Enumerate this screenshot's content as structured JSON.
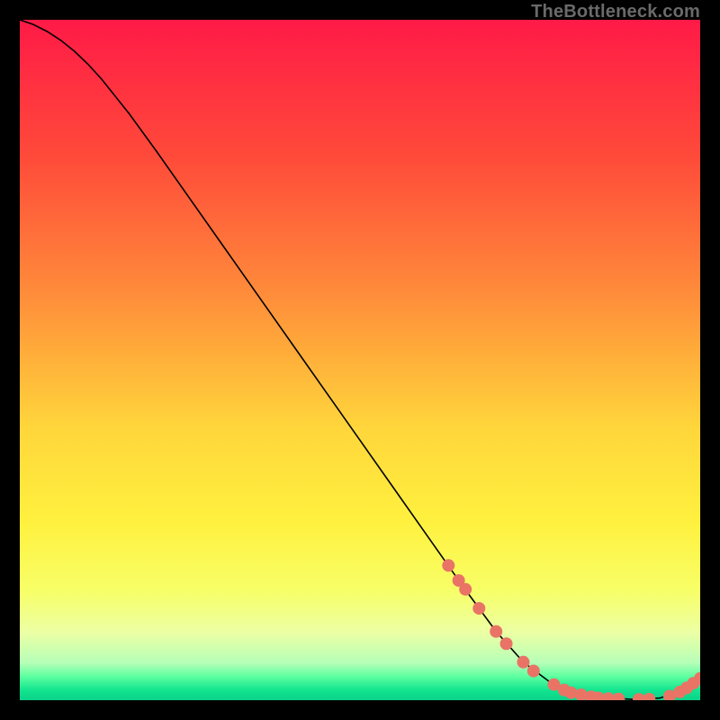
{
  "watermark": "TheBottleneck.com",
  "chart_data": {
    "type": "line",
    "title": "",
    "xlabel": "",
    "ylabel": "",
    "xlim": [
      0,
      100
    ],
    "ylim": [
      0,
      100
    ],
    "grid": false,
    "legend": false,
    "background": {
      "direction": "vertical",
      "stops": [
        {
          "pos": 0.0,
          "color": "#ff1a47"
        },
        {
          "pos": 0.2,
          "color": "#ff4a3a"
        },
        {
          "pos": 0.4,
          "color": "#ff8b3a"
        },
        {
          "pos": 0.6,
          "color": "#ffd63b"
        },
        {
          "pos": 0.74,
          "color": "#fff13f"
        },
        {
          "pos": 0.84,
          "color": "#f7ff68"
        },
        {
          "pos": 0.9,
          "color": "#ecffa4"
        },
        {
          "pos": 0.945,
          "color": "#b6ffb8"
        },
        {
          "pos": 0.965,
          "color": "#5effa0"
        },
        {
          "pos": 0.985,
          "color": "#12e58f"
        },
        {
          "pos": 1.0,
          "color": "#0bd188"
        }
      ]
    },
    "series": [
      {
        "name": "bottleneck-curve",
        "color": "#000000",
        "width": 1.6,
        "x": [
          0,
          2,
          4,
          6,
          8,
          10,
          12,
          16,
          20,
          25,
          30,
          35,
          40,
          45,
          50,
          55,
          60,
          65,
          70,
          74,
          78,
          82,
          86,
          90,
          94,
          97,
          100
        ],
        "y": [
          100,
          99.3,
          98.3,
          97.0,
          95.4,
          93.5,
          91.3,
          86.3,
          80.8,
          73.7,
          66.6,
          59.5,
          52.4,
          45.3,
          38.2,
          31.1,
          24.0,
          16.9,
          10.1,
          5.6,
          2.6,
          1.0,
          0.35,
          0.12,
          0.3,
          1.2,
          3.2
        ]
      }
    ],
    "markers": {
      "name": "highlighted-points",
      "color": "#e97466",
      "radius": 7,
      "points": [
        {
          "x": 63.0,
          "y": 19.8
        },
        {
          "x": 64.5,
          "y": 17.6
        },
        {
          "x": 65.5,
          "y": 16.3
        },
        {
          "x": 67.5,
          "y": 13.5
        },
        {
          "x": 70.0,
          "y": 10.1
        },
        {
          "x": 71.5,
          "y": 8.3
        },
        {
          "x": 74.0,
          "y": 5.6
        },
        {
          "x": 75.5,
          "y": 4.3
        },
        {
          "x": 78.5,
          "y": 2.3
        },
        {
          "x": 80.0,
          "y": 1.5
        },
        {
          "x": 81.0,
          "y": 1.1
        },
        {
          "x": 82.5,
          "y": 0.8
        },
        {
          "x": 84.0,
          "y": 0.5
        },
        {
          "x": 85.0,
          "y": 0.35
        },
        {
          "x": 86.5,
          "y": 0.25
        },
        {
          "x": 88.0,
          "y": 0.18
        },
        {
          "x": 91.0,
          "y": 0.12
        },
        {
          "x": 92.5,
          "y": 0.15
        },
        {
          "x": 95.5,
          "y": 0.6
        },
        {
          "x": 97.0,
          "y": 1.2
        },
        {
          "x": 98.0,
          "y": 1.8
        },
        {
          "x": 99.0,
          "y": 2.5
        },
        {
          "x": 100.0,
          "y": 3.2
        }
      ]
    }
  }
}
